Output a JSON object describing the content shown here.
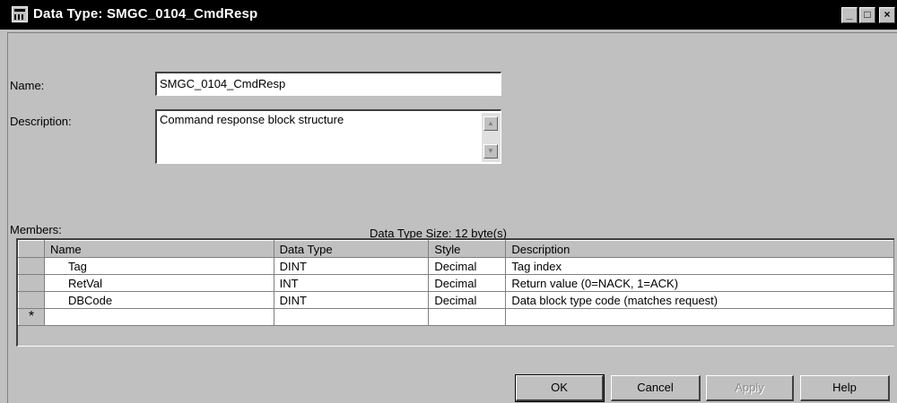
{
  "window": {
    "title": "Data Type:  SMGC_0104_CmdResp",
    "icon": "data-type-icon",
    "controls": {
      "minimize": "_",
      "maximize": "□",
      "close": "×"
    }
  },
  "form": {
    "name_label": "Name:",
    "name_value": "SMGC_0104_CmdResp",
    "description_label": "Description:",
    "description_value": "Command response block structure",
    "members_label": "Members:",
    "size_text": "Data Type Size: 12 byte(s)"
  },
  "grid": {
    "columns": [
      "Name",
      "Data Type",
      "Style",
      "Description"
    ],
    "rows": [
      {
        "name": "Tag",
        "type": "DINT",
        "style": "Decimal",
        "description": "Tag index"
      },
      {
        "name": "RetVal",
        "type": "INT",
        "style": "Decimal",
        "description": "Return value (0=NACK, 1=ACK)"
      },
      {
        "name": "DBCode",
        "type": "DINT",
        "style": "Decimal",
        "description": "Data block type code (matches request)"
      }
    ],
    "new_row_marker": "*"
  },
  "buttons": {
    "ok": "OK",
    "cancel": "Cancel",
    "apply": "Apply",
    "help": "Help"
  }
}
